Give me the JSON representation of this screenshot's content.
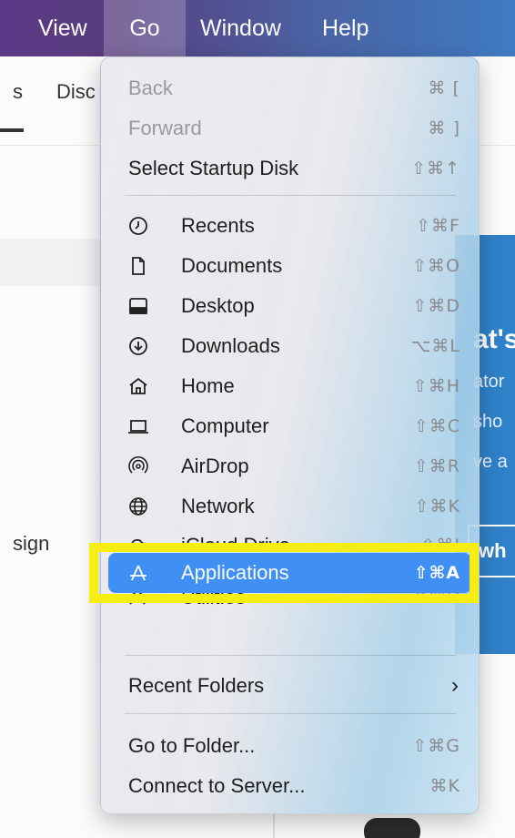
{
  "menubar": {
    "items": [
      "View",
      "Go",
      "Window",
      "Help"
    ],
    "active": "Go"
  },
  "background": {
    "tab_s": "s",
    "tab_disc": "Disc",
    "sign_text": "sign",
    "blue_panel": {
      "heading_fragment": "at's",
      "line1": "ator",
      "line2": "sho",
      "line3": "ve a",
      "button_fragment": "wh"
    }
  },
  "go_menu": {
    "top": [
      {
        "label": "Back",
        "shortcut": "⌘ [",
        "disabled": true
      },
      {
        "label": "Forward",
        "shortcut": "⌘ ]",
        "disabled": true
      },
      {
        "label": "Select Startup Disk",
        "shortcut": "⇧⌘↑",
        "disabled": false
      }
    ],
    "places": [
      {
        "label": "Recents",
        "icon": "clock-icon",
        "shortcut": "⇧⌘F"
      },
      {
        "label": "Documents",
        "icon": "document-icon",
        "shortcut": "⇧⌘O"
      },
      {
        "label": "Desktop",
        "icon": "desktop-icon",
        "shortcut": "⇧⌘D"
      },
      {
        "label": "Downloads",
        "icon": "download-icon",
        "shortcut": "⌥⌘L"
      },
      {
        "label": "Home",
        "icon": "home-icon",
        "shortcut": "⇧⌘H"
      },
      {
        "label": "Computer",
        "icon": "laptop-icon",
        "shortcut": "⇧⌘C"
      },
      {
        "label": "AirDrop",
        "icon": "airdrop-icon",
        "shortcut": "⇧⌘R"
      },
      {
        "label": "Network",
        "icon": "globe-icon",
        "shortcut": "⇧⌘K"
      }
    ],
    "icloud_partial": {
      "label": "iCloud Drive",
      "shortcut": "⇧⌘I"
    },
    "applications": {
      "label": "Applications",
      "icon": "applications-icon",
      "shortcut": "⇧⌘A"
    },
    "utilities_partial": {
      "label": "Utilities",
      "shortcut": "⇧⌘U"
    },
    "recent_folders": {
      "label": "Recent Folders",
      "arrow": "›"
    },
    "bottom": [
      {
        "label": "Go to Folder...",
        "shortcut": "⇧⌘G"
      },
      {
        "label": "Connect to Server...",
        "shortcut": "⌘K"
      }
    ]
  },
  "colors": {
    "selection": "#3f8ff5",
    "highlight_box": "#f6ee13",
    "menubar_start": "#5a3a86",
    "menubar_end": "#3f7bc2"
  }
}
